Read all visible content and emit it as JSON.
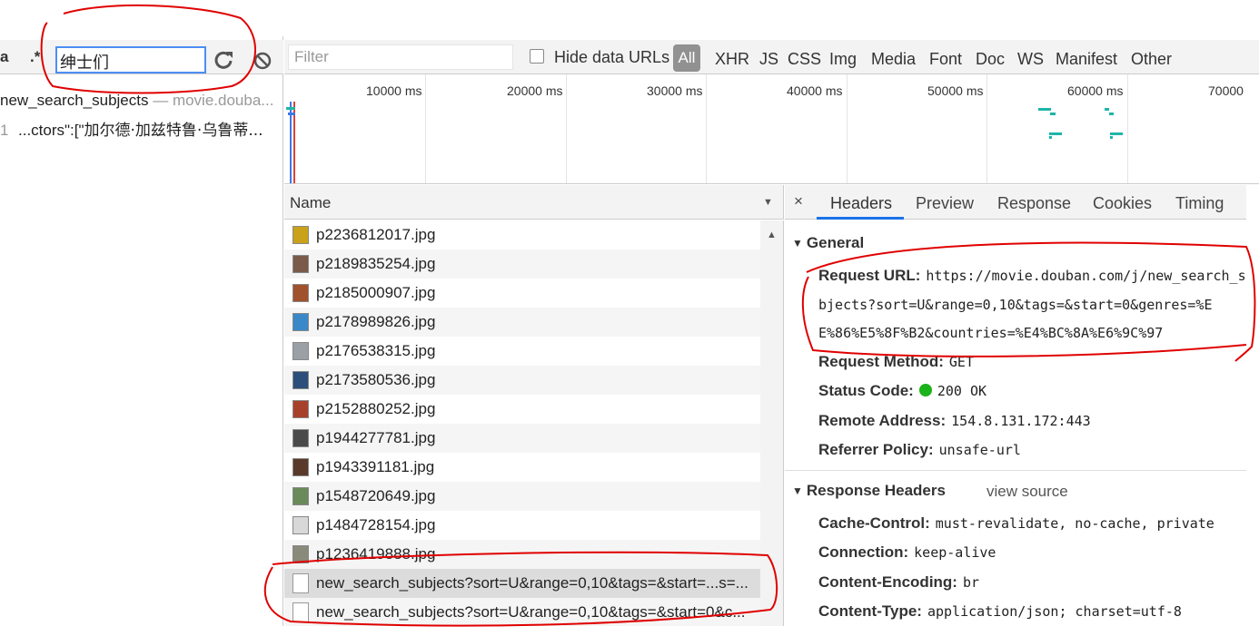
{
  "left_pane": {
    "toolbar": {
      "case_label": "a",
      "regex_label": ".*",
      "search_value": "绅士们"
    },
    "results": [
      {
        "name": "new_search_subjects",
        "separator": " — ",
        "url": "movie.douba..."
      },
      {
        "line_no": "1",
        "text": "...ctors\":[\"",
        "match": "加尔德·加兹特鲁·乌鲁蒂..."
      }
    ]
  },
  "filter_bar": {
    "filter_placeholder": "Filter",
    "hide_data_urls": "Hide data URLs",
    "all": "All",
    "types": [
      "XHR",
      "JS",
      "CSS",
      "Img",
      "Media",
      "Font",
      "Doc",
      "WS",
      "Manifest",
      "Other"
    ]
  },
  "timeline": {
    "ticks": [
      "10000 ms",
      "20000 ms",
      "30000 ms",
      "40000 ms",
      "50000 ms",
      "60000 ms",
      "70000"
    ]
  },
  "request_list": {
    "column_name": "Name",
    "rows": [
      {
        "name": "p2236812017.jpg",
        "type": "image",
        "thumb_color": "#c9a21a"
      },
      {
        "name": "p2189835254.jpg",
        "type": "image",
        "thumb_color": "#7a5a48"
      },
      {
        "name": "p2185000907.jpg",
        "type": "image",
        "thumb_color": "#a0522d"
      },
      {
        "name": "p2178989826.jpg",
        "type": "image",
        "thumb_color": "#3a88c8"
      },
      {
        "name": "p2176538315.jpg",
        "type": "image",
        "thumb_color": "#9aa0a6"
      },
      {
        "name": "p2173580536.jpg",
        "type": "image",
        "thumb_color": "#2b4f7a"
      },
      {
        "name": "p2152880252.jpg",
        "type": "image",
        "thumb_color": "#a8412b"
      },
      {
        "name": "p1944277781.jpg",
        "type": "image",
        "thumb_color": "#4a4a4a"
      },
      {
        "name": "p1943391181.jpg",
        "type": "image",
        "thumb_color": "#5a3a2a"
      },
      {
        "name": "p1548720649.jpg",
        "type": "image",
        "thumb_color": "#6a8a5a"
      },
      {
        "name": "p1484728154.jpg",
        "type": "image",
        "thumb_color": "#d8d8d8"
      },
      {
        "name": "p1236419888.jpg",
        "type": "image",
        "thumb_color": "#8a8a7a"
      },
      {
        "name": "new_search_subjects?sort=U&range=0,10&tags=&start=...s=...",
        "type": "doc",
        "selected": true
      },
      {
        "name": "new_search_subjects?sort=U&range=0,10&tags=&start=0&c...",
        "type": "doc"
      }
    ]
  },
  "detail": {
    "close": "×",
    "tabs": [
      "Headers",
      "Preview",
      "Response",
      "Cookies",
      "Timing"
    ],
    "general": {
      "title": "General",
      "request_url_label": "Request URL:",
      "request_url_lines": [
        "https://movie.douban.com/j/new_search_su",
        "bjects?sort=U&range=0,10&tags=&start=0&genres=%E",
        "E%86%E5%8F%B2&countries=%E4%BC%8A%E6%9C%97"
      ],
      "request_method_label": "Request Method:",
      "request_method": "GET",
      "status_code_label": "Status Code:",
      "status_code": "200 OK",
      "remote_address_label": "Remote Address:",
      "remote_address": "154.8.131.172:443",
      "referrer_policy_label": "Referrer Policy:",
      "referrer_policy": "unsafe-url"
    },
    "response_headers": {
      "title": "Response Headers",
      "view_source": "view source",
      "items": [
        {
          "key": "Cache-Control:",
          "value": "must-revalidate, no-cache, private"
        },
        {
          "key": "Connection:",
          "value": "keep-alive"
        },
        {
          "key": "Content-Encoding:",
          "value": "br"
        },
        {
          "key": "Content-Type:",
          "value": "application/json; charset=utf-8"
        }
      ]
    }
  },
  "colors": {
    "accent": "#1a73e8",
    "annotation": "#e00000",
    "waterfall": "#1fb5a8",
    "status_ok": "#19b31a"
  }
}
